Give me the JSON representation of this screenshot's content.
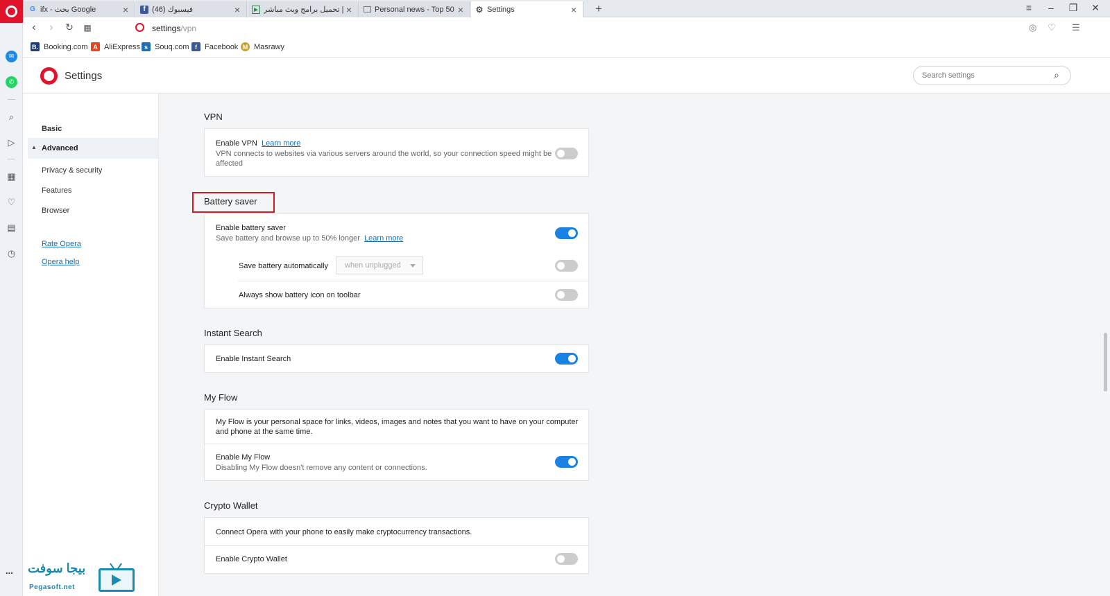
{
  "tabs": [
    {
      "title": "ifx - بحث Google",
      "favicon": "google-icon"
    },
    {
      "title": "(46) فيسبوك",
      "favicon": "facebook-icon"
    },
    {
      "title": "بث | تحميل برامج وبث مباشر",
      "favicon": "tv-icon"
    },
    {
      "title": "Personal news - Top 50",
      "favicon": "news-icon"
    },
    {
      "title": "Settings",
      "favicon": "gear-icon"
    }
  ],
  "address": {
    "url_host": "settings",
    "url_path": "/vpn"
  },
  "bookmarks": [
    {
      "label": "Booking.com",
      "color": "#1f3b7a",
      "glyph": "B."
    },
    {
      "label": "AliExpress",
      "color": "#e8441f",
      "glyph": "A"
    },
    {
      "label": "Souq.com",
      "color": "#1a6fb5",
      "glyph": "s"
    },
    {
      "label": "Facebook",
      "color": "#3b5998",
      "glyph": "f"
    },
    {
      "label": "Masrawy",
      "color": "#c9a227",
      "glyph": "M"
    }
  ],
  "header": {
    "title": "Settings",
    "search_placeholder": "Search settings"
  },
  "sidebar": {
    "basic": "Basic",
    "advanced": "Advanced",
    "items": [
      "Privacy & security",
      "Features",
      "Browser"
    ],
    "links": [
      "Rate Opera",
      "Opera help"
    ]
  },
  "vpn": {
    "title": "VPN",
    "enable_label": "Enable VPN",
    "learn_more": "Learn more",
    "desc_line1": "VPN connects to websites via various servers around the world, so your connection speed might be",
    "desc_line2": "affected",
    "enabled": false
  },
  "battery": {
    "title": "Battery saver",
    "enable_label": "Enable battery saver",
    "enable_desc": "Save battery and browse up to 50% longer",
    "learn_more": "Learn more",
    "enabled": true,
    "auto_label": "Save battery automatically",
    "auto_select": "when unplugged",
    "auto_enabled": false,
    "icon_label": "Always show battery icon on toolbar",
    "icon_enabled": false
  },
  "instant_search": {
    "title": "Instant Search",
    "enable_label": "Enable Instant Search",
    "enabled": true
  },
  "my_flow": {
    "title": "My Flow",
    "desc_line1": "My Flow is your personal space for links, videos, images and notes that you want to have on your computer",
    "desc_line2": "and phone at the same time.",
    "enable_label": "Enable My Flow",
    "enable_desc": "Disabling My Flow doesn't remove any content or connections.",
    "enabled": true
  },
  "crypto": {
    "title": "Crypto Wallet",
    "desc": "Connect Opera with your phone to easily make cryptocurrency transactions.",
    "enable_label": "Enable Crypto Wallet",
    "enabled": false
  },
  "watermark": {
    "arabic": "بيجا سوفت",
    "english": "Pegasoft.net",
    "dots": "..."
  },
  "colors": {
    "opera_red": "#e0132b",
    "toggle_on": "#1a82e2",
    "link": "#1a6fb5",
    "highlight": "#d41a26"
  }
}
